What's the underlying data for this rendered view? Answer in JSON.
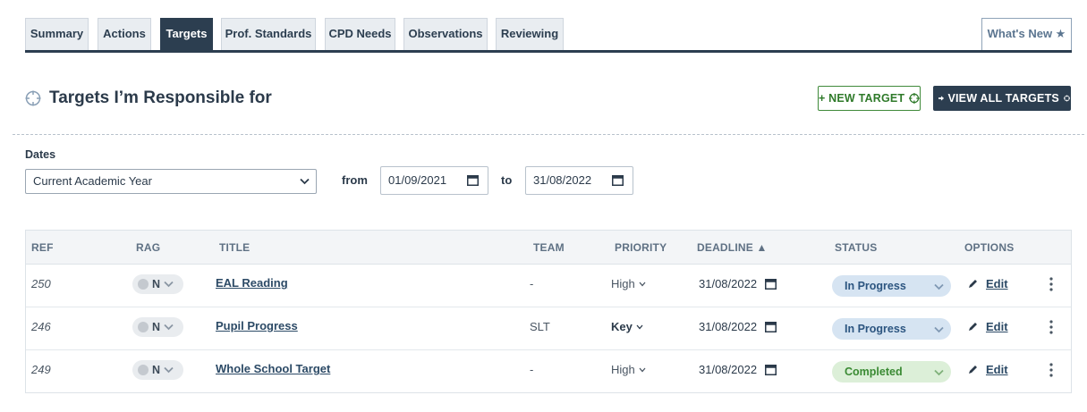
{
  "tabs": [
    {
      "label": "Summary"
    },
    {
      "label": "Actions"
    },
    {
      "label": "Targets"
    },
    {
      "label": "Prof. Standards"
    },
    {
      "label": "CPD Needs"
    },
    {
      "label": "Observations"
    },
    {
      "label": "Reviewing"
    }
  ],
  "whats_new": "What's New ★",
  "heading": "Targets I’m Responsible for",
  "buttons": {
    "new_target": "+ NEW TARGET",
    "view_all": "VIEW ALL TARGETS"
  },
  "filters": {
    "dates_label": "Dates",
    "range_value": "Current Academic Year",
    "from_label": "from",
    "from_value": "01/09/2021",
    "to_label": "to",
    "to_value": "31/08/2022"
  },
  "table": {
    "headers": {
      "ref": "REF",
      "rag": "RAG",
      "title": "TITLE",
      "team": "TEAM",
      "priority": "PRIORITY",
      "deadline": "DEADLINE ▲",
      "status": "STATUS",
      "options": "OPTIONS"
    },
    "rows": [
      {
        "ref": "250",
        "rag": "N",
        "title": "EAL Reading",
        "team": "-",
        "priority": "High",
        "deadline": "31/08/2022",
        "status": "In Progress",
        "edit": "Edit"
      },
      {
        "ref": "246",
        "rag": "N",
        "title": "Pupil Progress",
        "team": "SLT",
        "priority": "Key",
        "deadline": "31/08/2022",
        "status": "In Progress",
        "edit": "Edit"
      },
      {
        "ref": "249",
        "rag": "N",
        "title": "Whole School Target",
        "team": "-",
        "priority": "High",
        "deadline": "31/08/2022",
        "status": "Completed",
        "edit": "Edit"
      }
    ]
  },
  "colors": {
    "primary": "#2c3e50",
    "new_target_green": "#2f7a2a",
    "in_progress_bg": "#d6e4f2",
    "completed_bg": "#dcefd8"
  }
}
